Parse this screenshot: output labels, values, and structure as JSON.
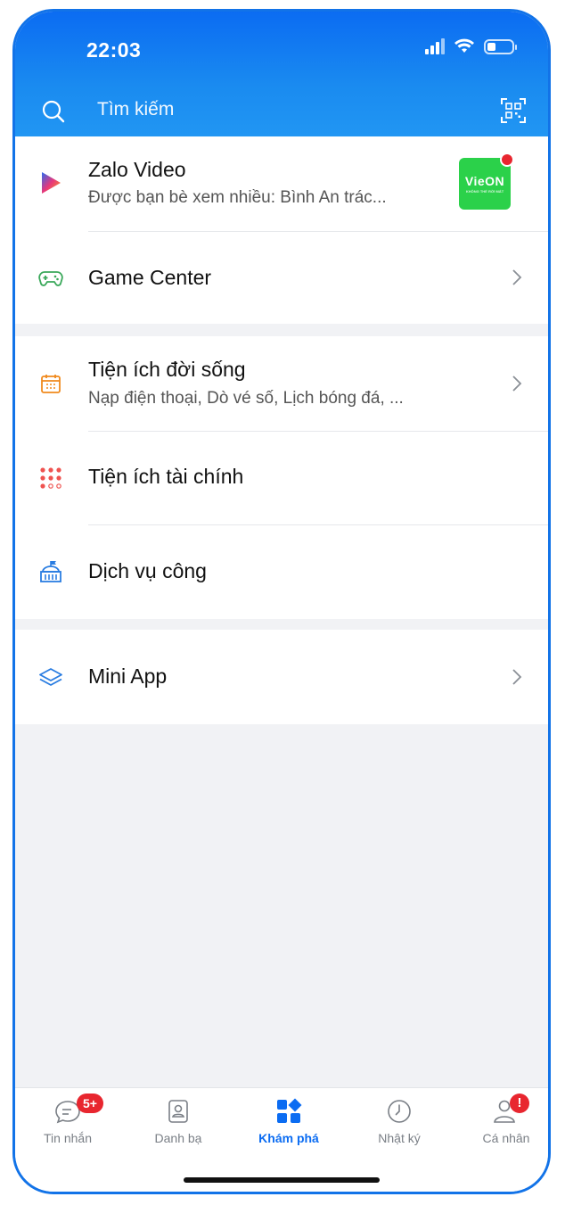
{
  "status_bar": {
    "time": "22:03"
  },
  "header": {
    "search_label": "Tìm kiếm",
    "search_icon": "search-icon",
    "qr_icon": "qr-scan-icon"
  },
  "sections": [
    {
      "items": [
        {
          "title": "Zalo Video",
          "subtitle": "Được bạn bè xem nhiều: Bình An trác...",
          "icon": "play-icon",
          "thumbnail": {
            "brand": "VieON",
            "tagline": "KHÔNG THỂ RỜI MẮT",
            "color": "#2bd14a"
          },
          "has_notification_dot": true
        },
        {
          "title": "Game Center",
          "icon": "gamepad-icon",
          "has_chevron": true
        }
      ]
    },
    {
      "items": [
        {
          "title": "Tiện ích đời sống",
          "subtitle": "Nạp điện thoại, Dò vé số, Lịch bóng đá, ...",
          "icon": "calendar-icon",
          "has_chevron": true
        },
        {
          "title": "Tiện ích tài chính",
          "icon": "dots-grid-icon"
        },
        {
          "title": "Dịch vụ công",
          "icon": "government-building-icon"
        }
      ]
    },
    {
      "items": [
        {
          "title": "Mini App",
          "icon": "layers-icon",
          "has_chevron": true
        }
      ]
    }
  ],
  "tabbar": {
    "tabs": [
      {
        "label": "Tin nhắn",
        "icon": "chat-icon",
        "badge": "5+"
      },
      {
        "label": "Danh bạ",
        "icon": "contacts-icon"
      },
      {
        "label": "Khám phá",
        "icon": "discover-icon",
        "active": true
      },
      {
        "label": "Nhật ký",
        "icon": "clock-icon"
      },
      {
        "label": "Cá nhân",
        "icon": "profile-icon",
        "badge": "!"
      }
    ]
  },
  "colors": {
    "accent": "#0b6cf2",
    "badge": "#e8262f",
    "background": "#f1f2f5"
  }
}
